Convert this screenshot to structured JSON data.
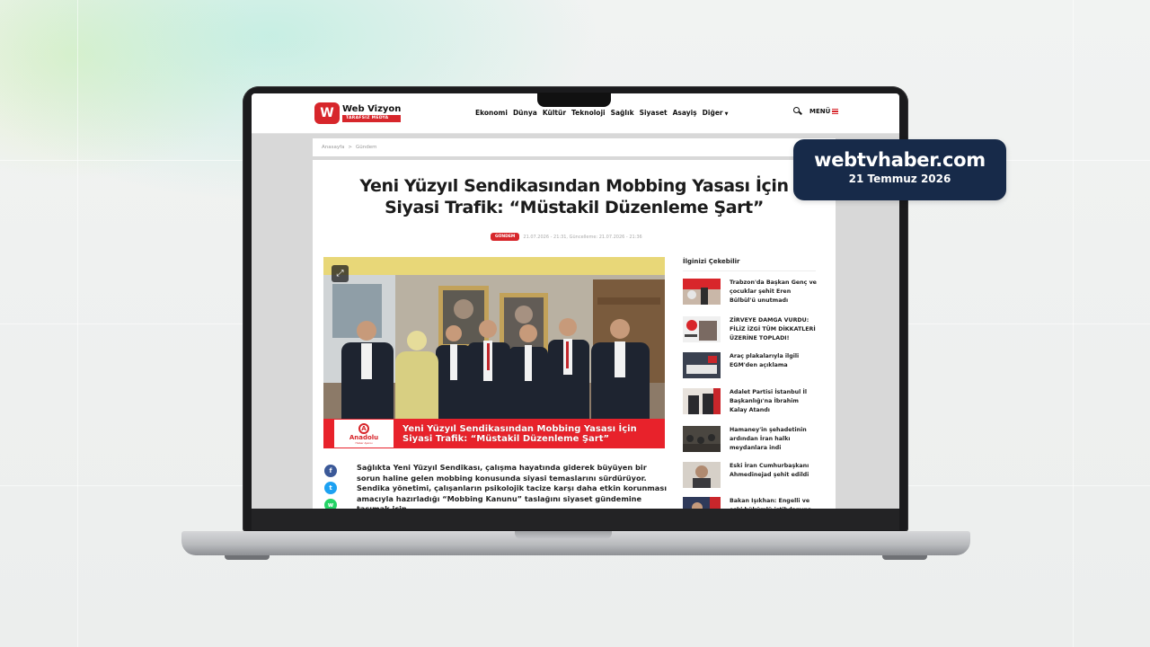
{
  "site": {
    "logo_letter": "W",
    "logo_name": "Web Vizyon",
    "logo_tagline": "TARAFSIZ MEDYA",
    "nav": [
      "Ekonomi",
      "Dünya",
      "Kültür",
      "Teknoloji",
      "Sağlık",
      "Siyaset",
      "Asayiş"
    ],
    "nav_more": "Diğer",
    "menu_label": "MENÜ",
    "icons": {
      "search": "search-icon",
      "menu": "hamburger-icon",
      "more": "chevron-down-icon"
    }
  },
  "breadcrumb": {
    "home": "Anasayfa",
    "separator": ">",
    "current": "Gündem"
  },
  "article": {
    "title": "Yeni Yüzyıl Sendikasından Mobbing Yasası İçin Siyasi Trafik: “Müstakil Düzenleme Şart”",
    "category": "GÜNDEM",
    "meta": "21.07.2026 - 21:31, Güncelleme: 21.07.2026 - 21:36",
    "photo_caption": "Yeni Yüzyıl Sendikasından Mobbing Yasası İçin Siyasi Trafik: “Müstakil Düzenleme Şart”",
    "agency_name": "Anadolu",
    "agency_sub": "Haber Ajansı",
    "agency_letter": "A",
    "body": "Sağlıkta Yeni Yüzyıl Sendikası, çalışma hayatında giderek büyüyen bir sorun haline gelen mobbing konusunda siyasi temaslarını sürdürüyor. Sendika yönetimi, çalışanların psikolojik tacize karşı daha etkin korunması amacıyla hazırladığı “Mobbing Kanunu” taslağını siyaset gündemine taşımak için",
    "share": [
      {
        "name": "facebook",
        "glyph": "f",
        "color": "#3b5998"
      },
      {
        "name": "twitter",
        "glyph": "t",
        "color": "#1da1f2"
      },
      {
        "name": "whatsapp",
        "glyph": "w",
        "color": "#25d366"
      }
    ]
  },
  "sidebar": {
    "title": "İlginizi Çekebilir",
    "items": [
      {
        "text": "Trabzon'da Başkan Genç ve çocuklar şehit Eren Bülbül'ü unutmadı"
      },
      {
        "text": "ZİRVEYE DAMGA VURDU: FİLİZ İZGİ TÜM DİKKATLERİ ÜZERİNE TOPLADI!"
      },
      {
        "text": "Araç plakalarıyla ilgili EGM'den açıklama"
      },
      {
        "text": "Adalet Partisi İstanbul İl Başkanlığı'na İbrahim Kalay Atandı"
      },
      {
        "text": "Hamaney'in şehadetinin ardından İran halkı meydanlara indi"
      },
      {
        "text": "Eski İran Cumhurbaşkanı Ahmedinejad şehit edildi"
      },
      {
        "text": "Bakan Işıkhan: Engelli ve eski hükümlü istihdamına"
      }
    ]
  },
  "overlay": {
    "url": "webtvhaber.com",
    "date": "21 Temmuz 2026"
  },
  "colors": {
    "brand_red": "#d7262b",
    "badge_navy": "#172a49"
  }
}
